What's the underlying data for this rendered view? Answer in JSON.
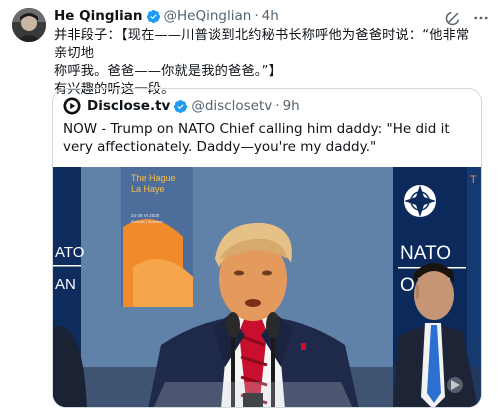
{
  "post": {
    "author_name": "He Qinglian",
    "author_handle": "@HeQinglian",
    "time": "4h",
    "text_line1": "并非段子：【现在——川普谈到北约秘书长称呼他为爸爸时说：“他非常亲切地",
    "text_line2": "称呼我。爸爸——你就是我的爸爸。”】",
    "text_line3": "有兴趣的听这一段。"
  },
  "quote": {
    "author_name": "Disclose.tv",
    "author_handle": "@disclosetv",
    "time": "9h",
    "text": "NOW - Trump on NATO Chief calling him daddy: \"He did it very affectionately. Daddy—you're my daddy.\""
  },
  "video": {
    "sign_hague_1": "The Hague",
    "sign_hague_2": "La Haye",
    "sign_date": "24-25 VI 2025",
    "sign_summit": "Summit | Sommet",
    "nato_left_1": "ATO",
    "nato_left_2": "AN",
    "nato_right_1": "NATO",
    "nato_right_2": "OTAN",
    "nato_far_right": "T"
  },
  "colors": {
    "verified_blue": "#1d9bf0",
    "muted_text": "#536471",
    "nato_navy": "#0b2a5b",
    "hague_orange": "#f18a2b"
  },
  "icons": {
    "verified": "verified-badge-icon",
    "grok": "grok-icon",
    "more": "more-options-icon",
    "disclose_logo": "disclose-logo-icon"
  }
}
